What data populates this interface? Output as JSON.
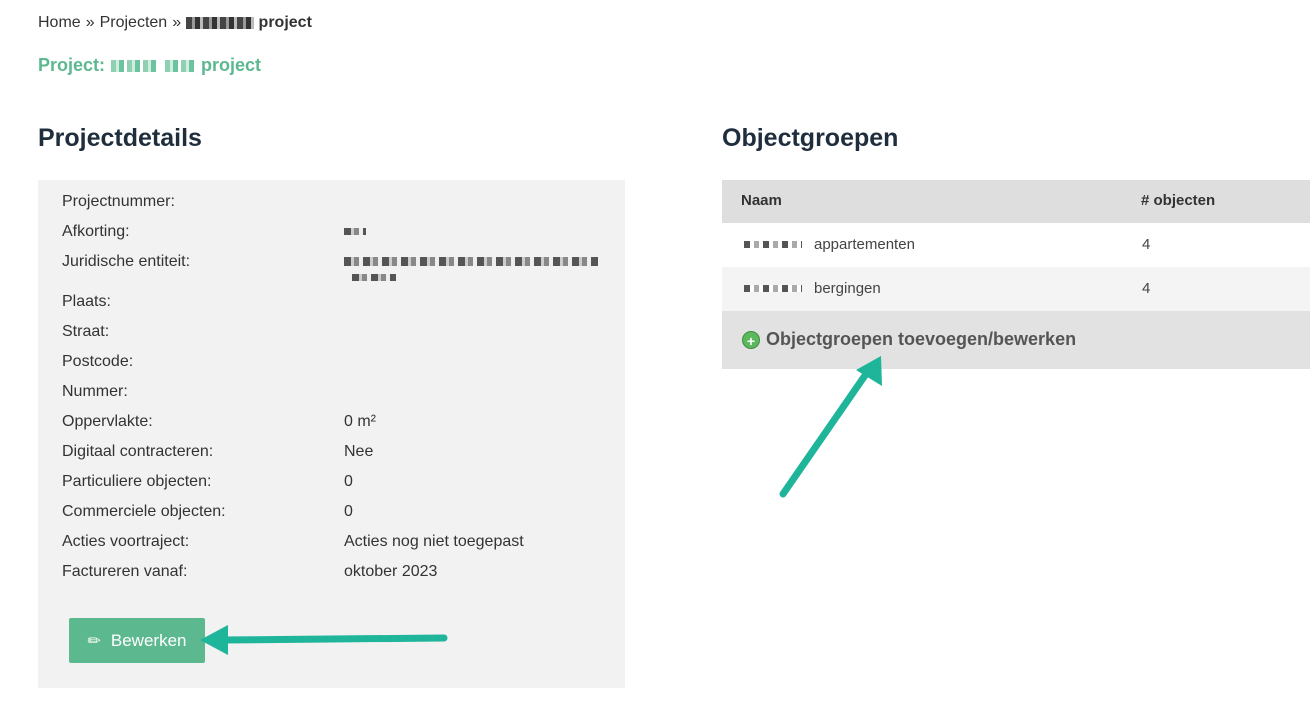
{
  "breadcrumb": {
    "home": "Home",
    "sep": "»",
    "projects": "Projecten",
    "current_suffix": "project"
  },
  "project_title": {
    "prefix": "Project:",
    "suffix": "project"
  },
  "details": {
    "heading": "Projectdetails",
    "rows": [
      {
        "label": "Projectnummer:",
        "value": ""
      },
      {
        "label": "Afkorting:",
        "value": ""
      },
      {
        "label": "Juridische entiteit:",
        "value": ""
      },
      {
        "label": "Plaats:",
        "value": ""
      },
      {
        "label": "Straat:",
        "value": ""
      },
      {
        "label": "Postcode:",
        "value": ""
      },
      {
        "label": "Nummer:",
        "value": ""
      },
      {
        "label": "Oppervlakte:",
        "value": "0 m²"
      },
      {
        "label": "Digitaal contracteren:",
        "value": "Nee"
      },
      {
        "label": "Particuliere objecten:",
        "value": "0"
      },
      {
        "label": "Commerciele objecten:",
        "value": "0"
      },
      {
        "label": "Acties voortraject:",
        "value": "Acties nog niet toegepast"
      },
      {
        "label": "Factureren vanaf:",
        "value": "oktober 2023"
      }
    ],
    "edit_button": "Bewerken"
  },
  "groups": {
    "heading": "Objectgroepen",
    "columns": [
      "Naam",
      "# objecten"
    ],
    "rows": [
      {
        "name": "appartementen",
        "count": "4"
      },
      {
        "name": "bergingen",
        "count": "4"
      }
    ],
    "footer_action": "Objectgroepen toevoegen/bewerken"
  },
  "colors": {
    "accent_green": "#5cb88f",
    "annotation_arrow": "#1fb59a",
    "heading": "#1f2d3d"
  }
}
